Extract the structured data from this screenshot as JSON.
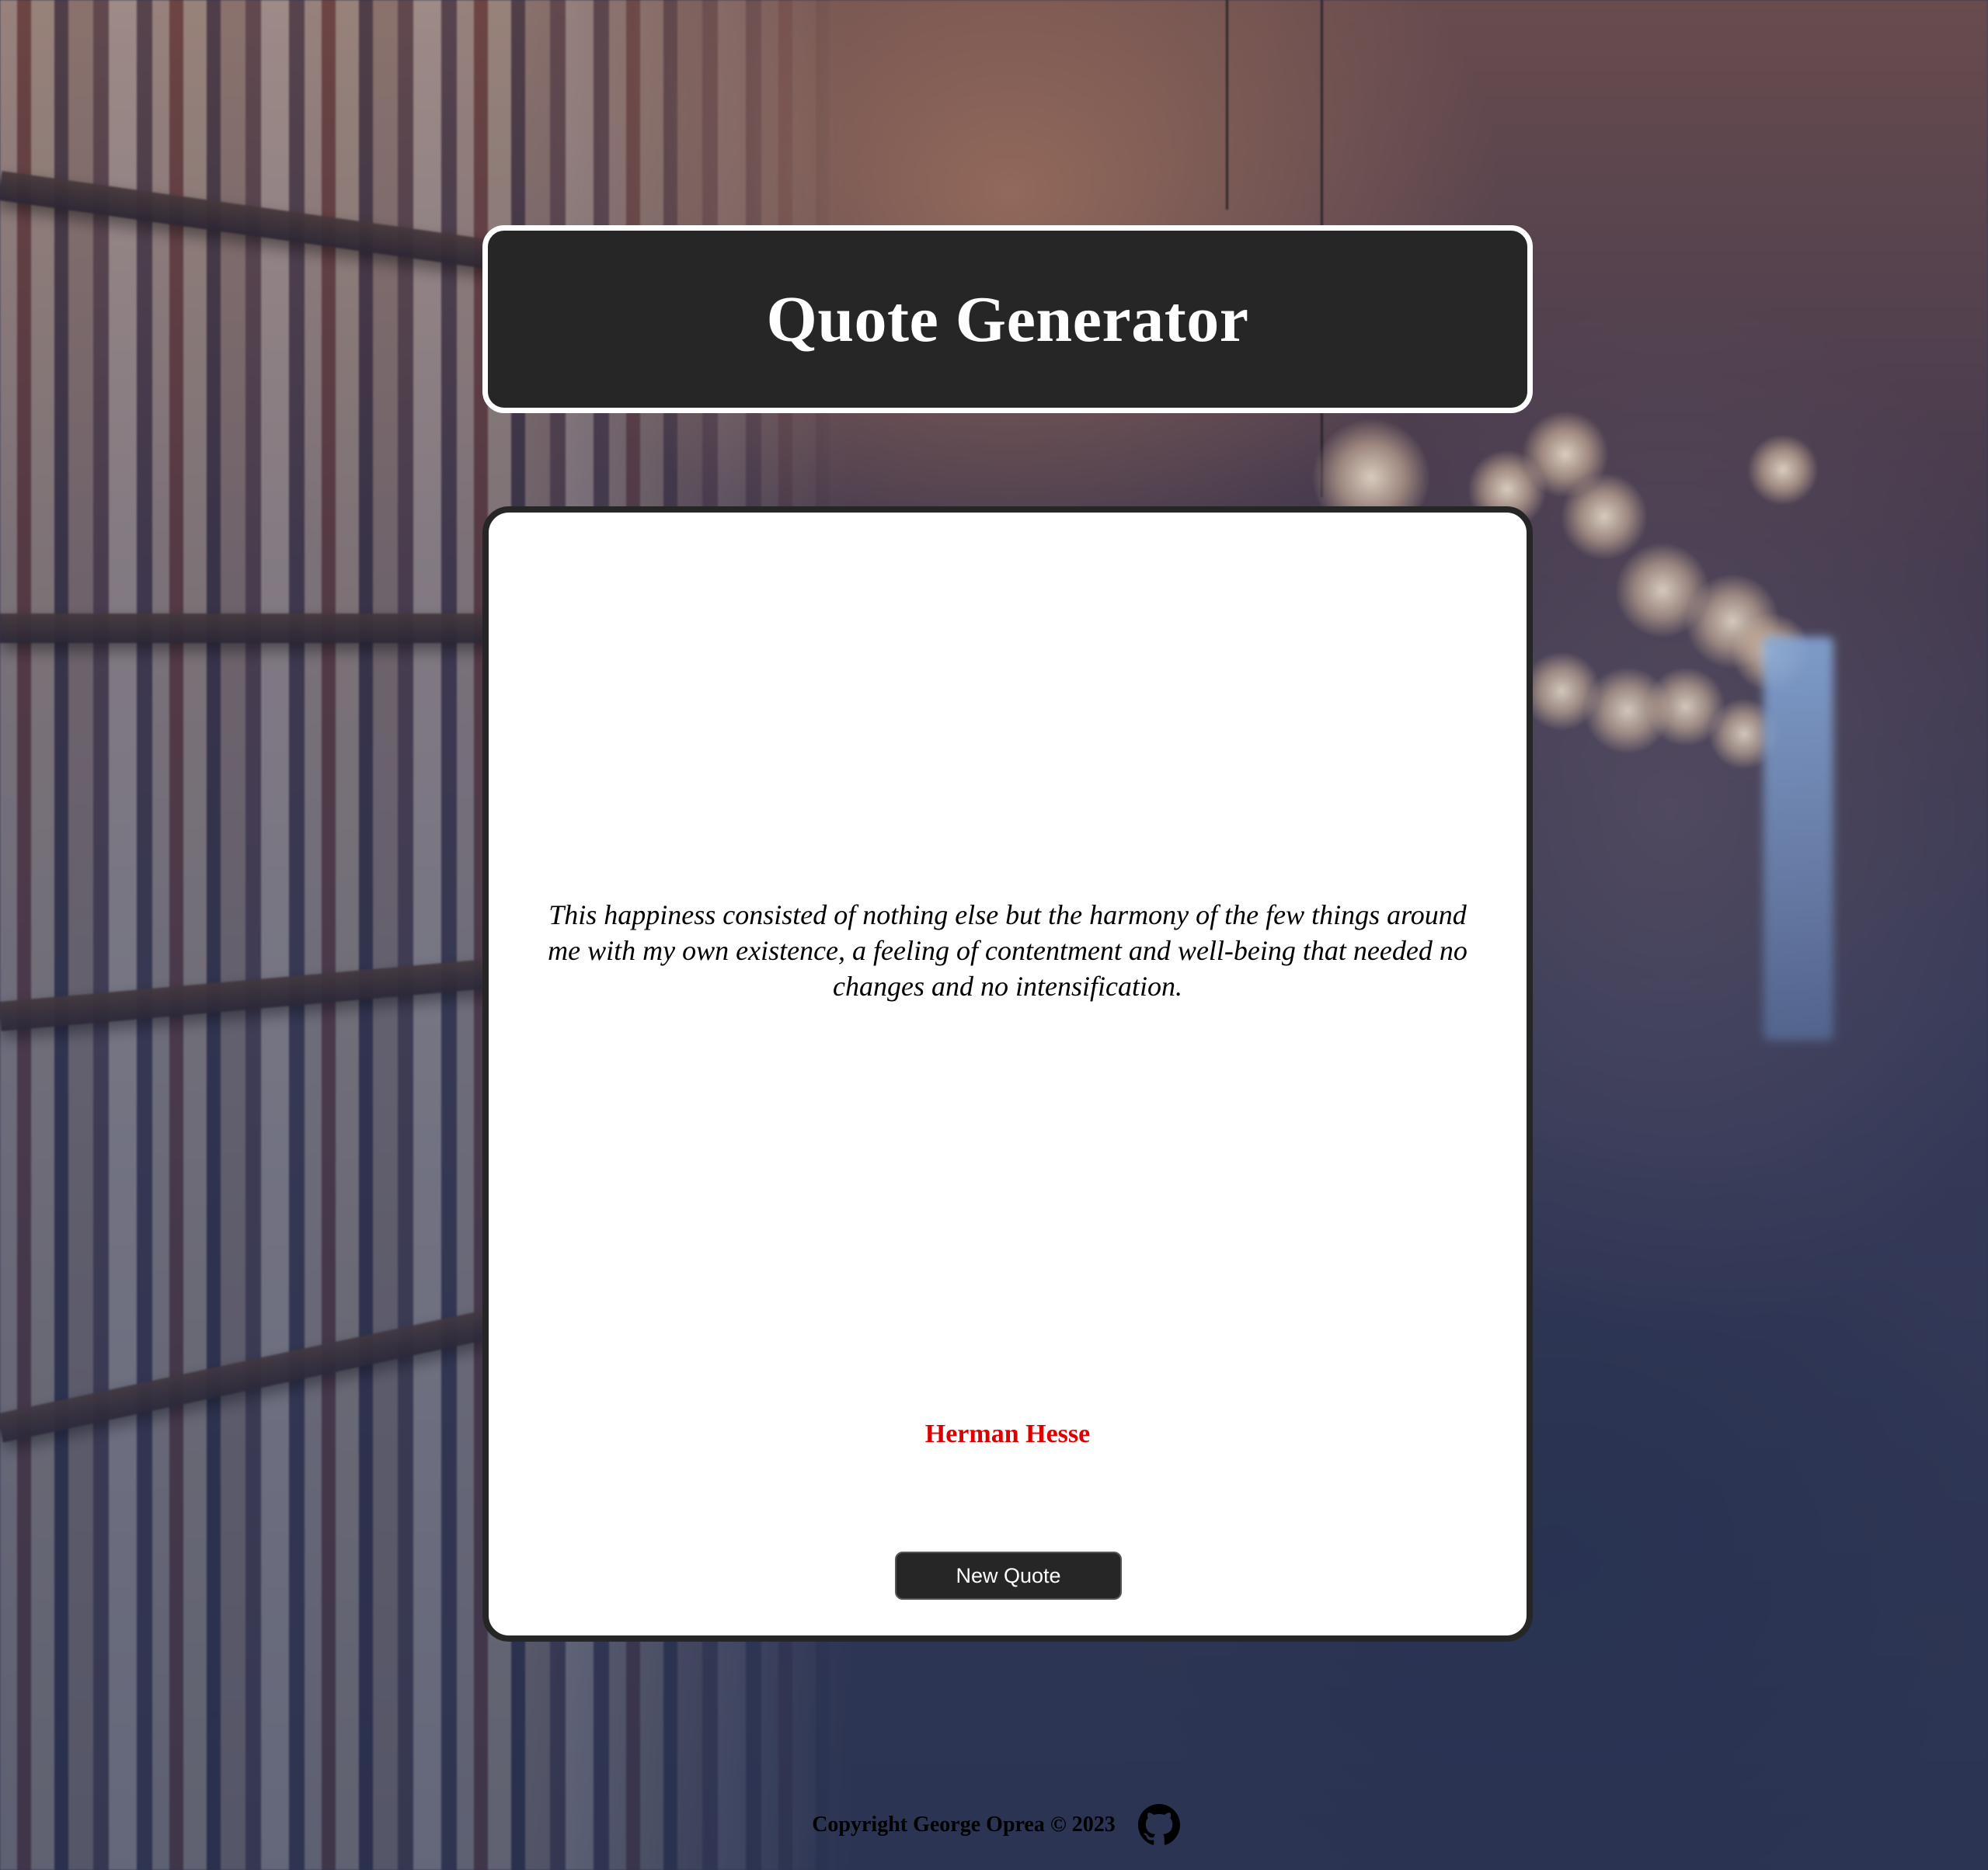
{
  "header": {
    "title": "Quote Generator"
  },
  "quote": {
    "text": "This happiness consisted of nothing else but the harmony of the few things around me with my own existence, a feeling of contentment and well-being that needed no changes and no intensification.",
    "author": "Herman Hesse",
    "button_label": "New Quote"
  },
  "footer": {
    "copyright": "Copyright George Oprea © 2023",
    "github_icon": "github-icon"
  },
  "colors": {
    "header_bg": "#262626",
    "card_bg": "#ffffff",
    "author": "#dd0000",
    "button_bg": "#262626"
  }
}
